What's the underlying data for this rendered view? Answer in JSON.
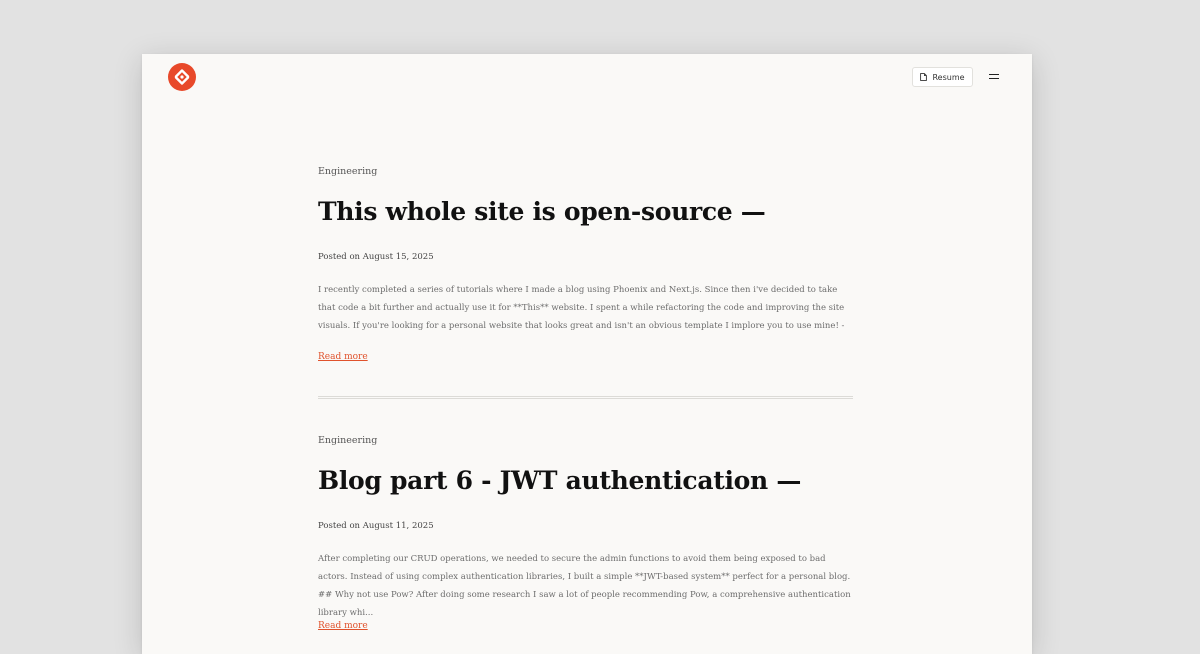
{
  "header": {
    "logo_color": "#e8492a",
    "resume_label": "Resume"
  },
  "colors": {
    "accent": "#e0522c",
    "background": "#faf9f7",
    "outer_background": "#e2e2e2"
  },
  "posts": [
    {
      "category": "Engineering",
      "title": "This whole site is open-source —",
      "date": "Posted on August 15, 2025",
      "excerpt": "I recently completed a series of tutorials where I made a blog using Phoenix and Next.js. Since then i've decided to take that code a bit further and actually use it for **This** website. I spent a while refactoring the code and improving the site visuals. If you're looking for a personal website that looks great and isn't an obvious template I implore you to use mine! -",
      "read_more": "Read more"
    },
    {
      "category": "Engineering",
      "title": "Blog part 6 - JWT authentication —",
      "date": "Posted on August 11, 2025",
      "excerpt": "After completing our CRUD operations, we needed to secure the admin functions to avoid them being exposed to bad actors. Instead of using complex authentication libraries, I built a simple **JWT-based system** perfect for a personal blog. ## Why not use Pow? After doing some research I saw a lot of people recommending Pow, a comprehensive authentication library whi...",
      "read_more": "Read more"
    }
  ]
}
